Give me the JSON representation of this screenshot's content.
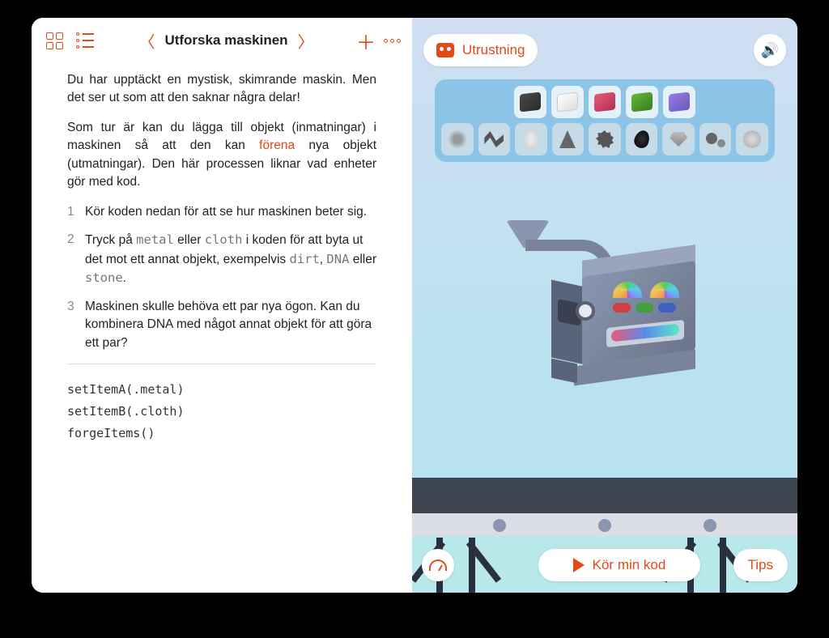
{
  "toolbar": {
    "title": "Utforska maskinen"
  },
  "content": {
    "para1": "Du har upptäckt en mystisk, skimrande maskin. Men det ser ut som att den saknar några delar!",
    "para2a": "Som tur är kan du lägga till objekt (inmatningar) i maskinen så att den kan ",
    "para2_link": "förena",
    "para2b": " nya objekt (utmatningar). Den här processen liknar vad enheter gör med kod.",
    "steps": [
      {
        "n": "1",
        "text": "Kör koden nedan för att se hur maskinen beter sig."
      },
      {
        "n": "2",
        "pre": "Tryck på ",
        "c1": "metal",
        "mid1": " eller ",
        "c2": "cloth",
        "mid2": " i koden för att byta ut det mot ett annat objekt, exempelvis ",
        "c3": "dirt",
        "mid3": ", ",
        "c4": "DNA",
        "mid4": " eller ",
        "c5": "stone",
        "end": "."
      },
      {
        "n": "3",
        "text": "Maskinen skulle behöva ett par nya ögon. Kan du kombinera DNA med något annat objekt för att göra ett par?"
      }
    ],
    "code": {
      "l1": "setItemA(.metal)",
      "l2": "setItemB(.cloth)",
      "l3": "forgeItems()"
    }
  },
  "right": {
    "equip_label": "Utrustning",
    "run_label": "Kör min kod",
    "tips_label": "Tips"
  }
}
